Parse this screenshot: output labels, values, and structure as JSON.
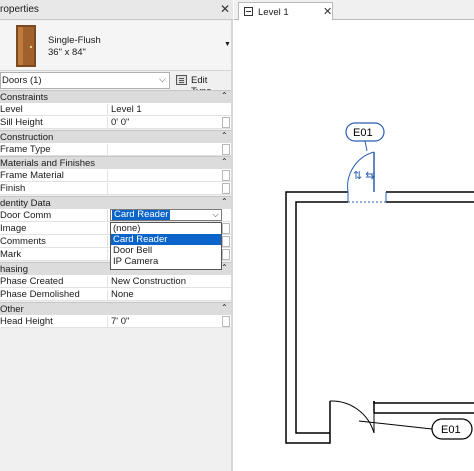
{
  "properties": {
    "title": "roperties",
    "close_glyph": "✕",
    "type_selector": {
      "family": "Single-Flush",
      "size": "36\" x 84\"",
      "arrow": "▼"
    },
    "filter": {
      "value": "Doors (1)",
      "chevron": "⌵"
    },
    "edit_type_label": "Edit Type",
    "collapse_glyph": "⌃",
    "sections": {
      "constraints": "Constraints",
      "construction": "Construction",
      "materials": "Materials and Finishes",
      "identity": "dentity Data",
      "phasing": "hasing",
      "other": "Other"
    },
    "params": {
      "level": {
        "name": "Level",
        "value": "Level 1"
      },
      "sill_height": {
        "name": "Sill Height",
        "value": "0'  0\""
      },
      "frame_type": {
        "name": "Frame Type",
        "value": ""
      },
      "frame_material": {
        "name": "Frame Material",
        "value": ""
      },
      "finish": {
        "name": "Finish",
        "value": ""
      },
      "door_comm": {
        "name": "Door Comm",
        "value": "Card Reader"
      },
      "image": {
        "name": "Image",
        "value": ""
      },
      "comments": {
        "name": "Comments",
        "value": ""
      },
      "mark": {
        "name": "Mark",
        "value": ""
      },
      "phase_created": {
        "name": "Phase Created",
        "value": "New Construction"
      },
      "phase_demolished": {
        "name": "Phase Demolished",
        "value": "None"
      },
      "head_height": {
        "name": "Head Height",
        "value": "7'  0\""
      }
    },
    "dropdown": {
      "button_glyph": "⌵",
      "options": [
        "(none)",
        "Card Reader",
        "Door Bell",
        "IP Camera"
      ],
      "highlighted": "Card Reader"
    }
  },
  "view": {
    "tab_label": "Level 1",
    "tab_close": "✕",
    "tag_top": "E01",
    "tag_bottom": "E01",
    "swap_symbol": "⇅ ⇆"
  },
  "colors": {
    "selection": "#0a64c9",
    "door_leaf": "#a0b8d8",
    "door_thumb": "#a0612c"
  }
}
